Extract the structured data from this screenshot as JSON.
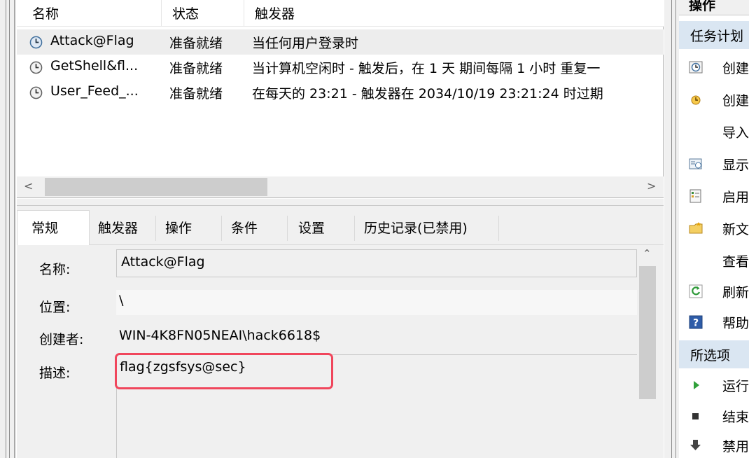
{
  "task_list": {
    "columns": [
      "名称",
      "状态",
      "触发器"
    ],
    "rows": [
      {
        "name": "Attack@Flag",
        "status": "准备就绪",
        "trigger": "当任何用户登录时"
      },
      {
        "name": "GetShell&fl...",
        "status": "准备就绪",
        "trigger": "当计算机空闲时 - 触发后，在 1 天 期间每隔 1 小时 重复一"
      },
      {
        "name": "User_Feed_...",
        "status": "准备就绪",
        "trigger": "在每天的 23:21 - 触发器在 2034/10/19 23:21:24 时过期"
      }
    ]
  },
  "detail": {
    "tabs": [
      "常规",
      "触发器",
      "操作",
      "条件",
      "设置",
      "历史记录(已禁用)"
    ],
    "fields": {
      "name_label": "名称:",
      "name_value": "Attack@Flag",
      "location_label": "位置:",
      "location_value": "\\",
      "author_label": "创建者:",
      "author_value": "WIN-4K8FN05NEAI\\hack6618$",
      "description_label": "描述:",
      "description_value": "flag{zgsfsys@sec}"
    }
  },
  "actions": {
    "title": "操作",
    "section1": "任务计划",
    "items1": [
      {
        "label": "创建",
        "icon": "create-basic-task-icon"
      },
      {
        "label": "创建",
        "icon": "create-task-icon"
      },
      {
        "label": "导入",
        "icon": ""
      },
      {
        "label": "显示",
        "icon": "display-running-tasks-icon"
      },
      {
        "label": "启用",
        "icon": "enable-history-icon"
      },
      {
        "label": "新文",
        "icon": "new-folder-icon"
      },
      {
        "label": "查看",
        "icon": ""
      },
      {
        "label": "刷新",
        "icon": "refresh-icon"
      },
      {
        "label": "帮助",
        "icon": "help-icon"
      }
    ],
    "section2": "所选项",
    "items2": [
      {
        "label": "运行",
        "icon": "run-icon"
      },
      {
        "label": "结束",
        "icon": "end-icon"
      },
      {
        "label": "禁用",
        "icon": "disable-icon"
      }
    ]
  },
  "colors": {
    "highlight": "#f0465c",
    "section_bg": "#dae6f2",
    "selected_row": "#ededed"
  }
}
